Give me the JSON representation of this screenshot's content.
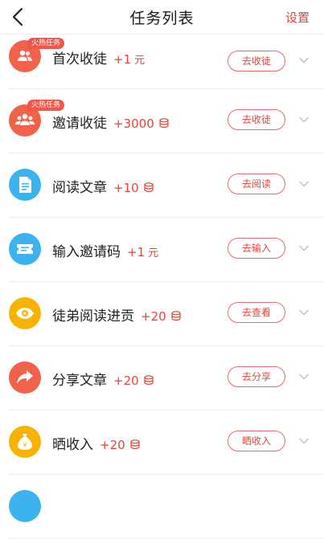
{
  "header": {
    "title": "任务列表",
    "settings": "设置"
  },
  "tasks": [
    {
      "name": "首次收徒",
      "reward": "+1",
      "unit": "元",
      "unit_type": "text",
      "button": "去收徒",
      "badge": "火热任务",
      "icon": "users-icon",
      "color": "#f1624a"
    },
    {
      "name": "邀请收徒",
      "reward": "+3000",
      "unit_type": "coin",
      "button": "去收徒",
      "badge": "火热任务",
      "icon": "group-icon",
      "color": "#f1624a"
    },
    {
      "name": "阅读文章",
      "reward": "+10",
      "unit_type": "coin",
      "button": "去阅读",
      "icon": "document-icon",
      "color": "#3cb3ef"
    },
    {
      "name": "输入邀请码",
      "reward": "+1",
      "unit": "元",
      "unit_type": "text",
      "button": "去输入",
      "icon": "ticket-icon",
      "color": "#3cb3ef"
    },
    {
      "name": "徒弟阅读进贡",
      "reward": "+20",
      "unit_type": "coin",
      "button": "去查看",
      "icon": "eye-icon",
      "color": "#f8b200"
    },
    {
      "name": "分享文章",
      "reward": "+20",
      "unit_type": "coin",
      "button": "去分享",
      "icon": "share-icon",
      "color": "#f1624a"
    },
    {
      "name": "晒收入",
      "reward": "+20",
      "unit_type": "coin",
      "button": "晒收入",
      "icon": "money-bag-icon",
      "color": "#f8b200"
    },
    {
      "name": "",
      "reward": "",
      "unit_type": "none",
      "button": "",
      "icon": "partial-icon",
      "color": "#3cb3ef"
    }
  ]
}
